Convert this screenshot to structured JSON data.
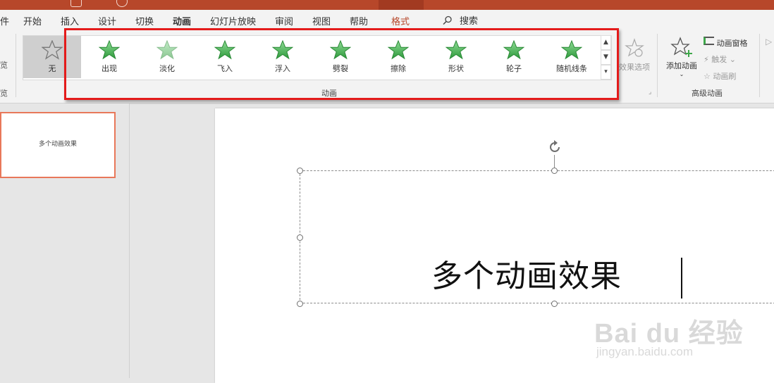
{
  "ribbon_tabs": [
    "件",
    "开始",
    "插入",
    "设计",
    "切换",
    "动画",
    "幻灯片放映",
    "审阅",
    "视图",
    "帮助",
    "格式"
  ],
  "active_tab": "动画",
  "contextual_tab": "格式",
  "search_label": "搜索",
  "left_stub": {
    "top": "览",
    "bottom": "览"
  },
  "animation_gallery": {
    "none_label": "无",
    "items": [
      "出现",
      "淡化",
      "飞入",
      "浮入",
      "劈裂",
      "擦除",
      "形状",
      "轮子",
      "随机线条"
    ],
    "group_label": "动画"
  },
  "effect_options_label": "效果选项",
  "advanced": {
    "add_animation_label": "添加动画",
    "animation_pane_label": "动画窗格",
    "trigger_label": "触发",
    "painter_label": "动画刷",
    "group_label": "高级动画"
  },
  "thumbnail_text": "多个动画效果",
  "slide_text": "多个动画效果",
  "watermark": {
    "logo": "Bai du 经验",
    "url": "jingyan.baidu.com"
  },
  "colors": {
    "accent": "#b7472a",
    "star_green": "#3ea84a",
    "highlight": "#e41b1b"
  }
}
